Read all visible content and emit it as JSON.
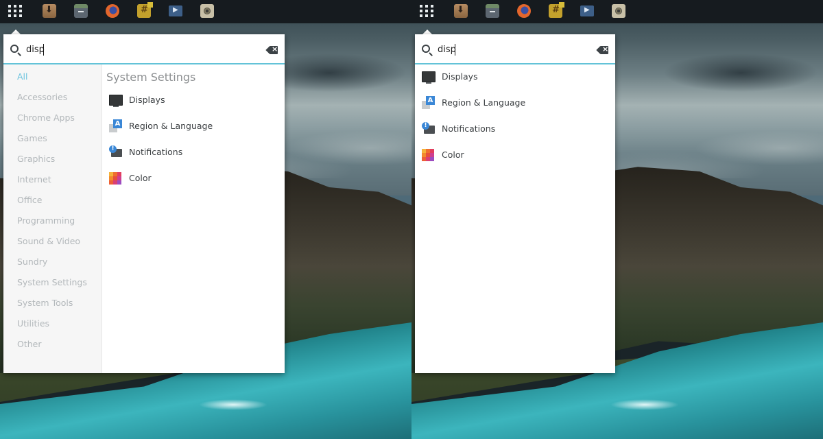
{
  "panel": {
    "launcher_icons": [
      "downloads-icon",
      "archive-manager-icon",
      "firefox-icon",
      "hexchat-icon",
      "video-player-icon",
      "speaker-icon"
    ]
  },
  "search": {
    "query": "disp"
  },
  "categories": [
    "All",
    "Accessories",
    "Chrome Apps",
    "Games",
    "Graphics",
    "Internet",
    "Office",
    "Programming",
    "Sound & Video",
    "Sundry",
    "System Settings",
    "System Tools",
    "Utilities",
    "Other"
  ],
  "active_category": "All",
  "section_title": "System Settings",
  "results": [
    {
      "label": "Displays",
      "icon": "display-icon"
    },
    {
      "label": "Region & Language",
      "icon": "region-language-icon"
    },
    {
      "label": "Notifications",
      "icon": "notifications-icon"
    },
    {
      "label": "Color",
      "icon": "color-icon"
    }
  ],
  "colors": {
    "accent": "#63c3d8",
    "panel": "#161b1f",
    "active_category": "#6ec4df"
  }
}
